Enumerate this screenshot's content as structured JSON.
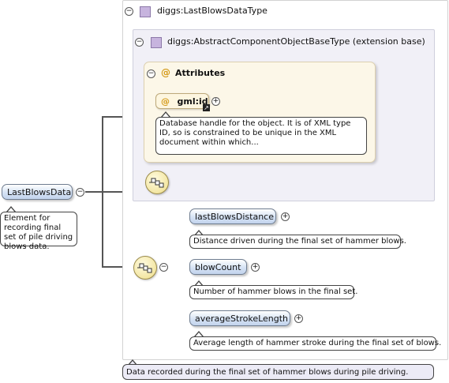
{
  "outer_type": {
    "label": "diggs:LastBlowsDataType",
    "toggle": "−"
  },
  "extension_type": {
    "label": "diggs:AbstractComponentObjectBaseType (extension base)",
    "toggle": "−"
  },
  "attributes": {
    "title": "Attributes",
    "toggle": "−",
    "at_symbol": "@",
    "items": [
      {
        "name": "gml:id",
        "doc": "Database handle for the object. It is of XML type ID, so is constrained to be unique in the XML document within which..."
      }
    ]
  },
  "root_element": {
    "name": "LastBlowsData",
    "toggle": "−",
    "doc": "Element for recording final set of pile driving blows data."
  },
  "sequence": {
    "toggle": "−"
  },
  "children": [
    {
      "name": "lastBlowsDistance",
      "expand": "+",
      "doc": "Distance driven during the final set of hammer blows."
    },
    {
      "name": "blowCount",
      "expand": "+",
      "doc": "Number of hammer blows in the final set."
    },
    {
      "name": "averageStrokeLength",
      "expand": "+",
      "doc": "Average length of hammer stroke during the final set of blows."
    }
  ],
  "type_doc": "Data recorded during the final set of hammer blows during pile driving.",
  "colors": {
    "element_gradient": [
      "#ffffff",
      "#c2d3ec"
    ],
    "type_icon": "#c7b4de",
    "attribute_bg": "#fcf7e8",
    "sequence_fill": "#f3e6a3",
    "extension_bg": "#f1f0f7"
  },
  "icons": {
    "collapse": "minus-circle-icon",
    "expand": "plus-circle-icon",
    "type": "complex-type-icon",
    "attribute": "at-sign-icon",
    "sequence": "sequence-compositor-icon",
    "link": "link-arrow-icon"
  }
}
